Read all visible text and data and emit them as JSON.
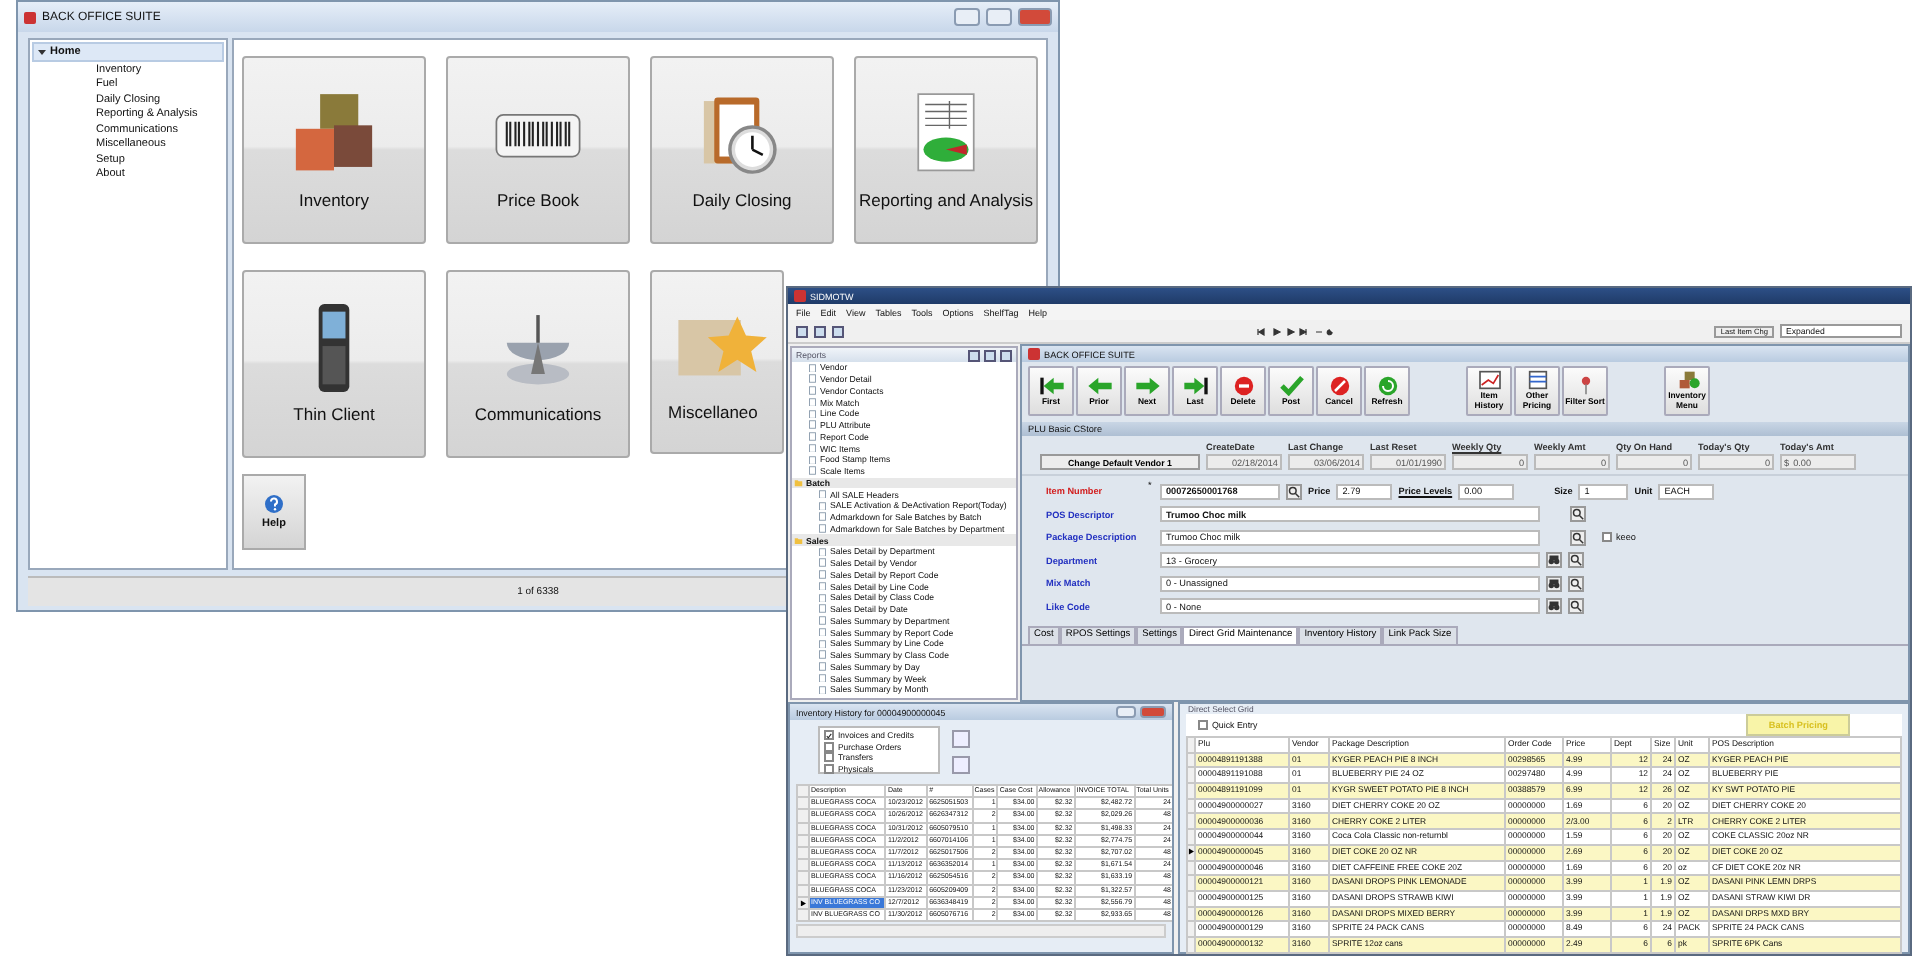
{
  "home_window": {
    "title": "BACK OFFICE SUITE",
    "sidebar": {
      "items": [
        {
          "label": "Home",
          "selected": true,
          "expanded": true,
          "children": [
            {
              "label": "Inventory",
              "selected": false
            },
            {
              "label": "Fuel",
              "selected": false
            },
            {
              "label": "Daily Closing",
              "selected": false
            },
            {
              "label": "Reporting & Analysis",
              "selected": false
            },
            {
              "label": "Communications",
              "selected": false
            },
            {
              "label": "Miscellaneous",
              "selected": false
            },
            {
              "label": "Setup",
              "selected": false
            },
            {
              "label": "About",
              "selected": false
            }
          ]
        }
      ]
    },
    "tiles": [
      {
        "label": "Inventory"
      },
      {
        "label": "Price Book"
      },
      {
        "label": "Daily Closing"
      },
      {
        "label": "Reporting and Analysis"
      },
      {
        "label": "Thin Client"
      },
      {
        "label": "Communications"
      },
      {
        "label": "Miscellaneo"
      }
    ],
    "help": {
      "label": "Help"
    },
    "status_bar": "1 of 6338"
  },
  "main_window": {
    "title": "SIDMOTW",
    "menu": [
      "File",
      "Edit",
      "View",
      "Tables",
      "Tools",
      "Options",
      "ShelfTag",
      "Help"
    ],
    "toolbar": {
      "last_item_button": "Last Item Chg",
      "view_select": "Expanded"
    },
    "reports": {
      "title": "Reports",
      "items": [
        {
          "kind": "leaf",
          "label": "Vendor"
        },
        {
          "kind": "leaf",
          "label": "Vendor Detail"
        },
        {
          "kind": "leaf",
          "label": "Vendor Contacts"
        },
        {
          "kind": "leaf",
          "label": "Mix Match"
        },
        {
          "kind": "leaf",
          "label": "Line Code"
        },
        {
          "kind": "leaf",
          "label": "PLU Attribute"
        },
        {
          "kind": "leaf",
          "label": "Report Code"
        },
        {
          "kind": "leaf",
          "label": "WIC Items"
        },
        {
          "kind": "leaf",
          "label": "Food Stamp Items"
        },
        {
          "kind": "leaf",
          "label": "Scale Items"
        },
        {
          "kind": "folder",
          "label": "Batch",
          "children": [
            {
              "kind": "leaf",
              "label": "All SALE Headers"
            },
            {
              "kind": "leaf",
              "label": "SALE Activation & DeActivation  Report(Today)"
            },
            {
              "kind": "leaf",
              "label": "Admarkdown for Sale Batches by Batch"
            },
            {
              "kind": "leaf",
              "label": "Admarkdown for Sale Batches by Department"
            }
          ]
        },
        {
          "kind": "folder",
          "label": "Sales",
          "children": [
            {
              "kind": "leaf",
              "label": "Sales Detail by Department"
            },
            {
              "kind": "leaf",
              "label": "Sales Detail by Vendor"
            },
            {
              "kind": "leaf",
              "label": "Sales Detail by Report Code"
            },
            {
              "kind": "leaf",
              "label": "Sales Detail by Line Code"
            },
            {
              "kind": "leaf",
              "label": "Sales Detail by Class Code"
            },
            {
              "kind": "leaf",
              "label": "Sales Detail by Date"
            },
            {
              "kind": "leaf",
              "label": "Sales Summary by Department"
            },
            {
              "kind": "leaf",
              "label": "Sales Summary by Report Code"
            },
            {
              "kind": "leaf",
              "label": "Sales Summary by Line Code"
            },
            {
              "kind": "leaf",
              "label": "Sales Summary by Class Code"
            },
            {
              "kind": "leaf",
              "label": "Sales Summary by Day"
            },
            {
              "kind": "leaf",
              "label": "Sales Summary by Week"
            },
            {
              "kind": "leaf",
              "label": "Sales Summary by Month"
            }
          ]
        }
      ]
    },
    "plu_window": {
      "title": "BACK OFFICE SUITE",
      "buttons": [
        {
          "label": "First"
        },
        {
          "label": "Prior"
        },
        {
          "label": "Next"
        },
        {
          "label": "Last"
        },
        {
          "label": "Delete"
        },
        {
          "label": "Post"
        },
        {
          "label": "Cancel"
        },
        {
          "label": "Refresh"
        },
        {
          "label": "Item History"
        },
        {
          "label": "Other Pricing"
        },
        {
          "label": "Filter Sort"
        },
        {
          "label": "Inventory Menu"
        }
      ],
      "section_title": "PLU Basic CStore",
      "vendor_button": "Change Default Vendor 1",
      "header_fields": [
        {
          "label": "CreateDate",
          "value": "02/18/2014",
          "underlined": false
        },
        {
          "label": "Last Change",
          "value": "03/06/2014",
          "underlined": false
        },
        {
          "label": "Last Reset",
          "value": "01/01/1990",
          "underlined": false
        },
        {
          "label": "Weekly Qty",
          "value": "0",
          "underlined": true
        },
        {
          "label": "Weekly Amt",
          "value": "0",
          "underlined": false
        },
        {
          "label": "Qty On Hand",
          "value": "0",
          "underlined": false
        },
        {
          "label": "Today's Qty",
          "value": "0",
          "underlined": false
        },
        {
          "label": "Today's Amt",
          "prefix": "$",
          "value": "0.00",
          "underlined": false
        }
      ],
      "item_number": {
        "label": "Item Number",
        "mark": "*",
        "value": "00072650001768"
      },
      "price": {
        "label": "Price",
        "value": "2.79"
      },
      "price_levels": {
        "label": "Price Levels",
        "value": "0.00"
      },
      "size": {
        "label": "Size",
        "value": "1"
      },
      "unit": {
        "label": "Unit",
        "value": "EACH"
      },
      "descriptor_fields": [
        {
          "label": "POS Descriptor",
          "value": "Trumoo Choc milk",
          "bold": true
        },
        {
          "label": "Package Description",
          "value": "Trumoo Choc milk",
          "bold": false
        }
      ],
      "keeo": {
        "label": "keeo",
        "checked": false
      },
      "lookup_fields": [
        {
          "label": "Department",
          "value": "13 - Grocery"
        },
        {
          "label": "Mix Match",
          "value": "0 - Unassigned"
        },
        {
          "label": "Like Code",
          "value": "0 - None"
        }
      ],
      "tabs": [
        {
          "label": "Cost",
          "selected": false
        },
        {
          "label": "RPOS Settings",
          "selected": false
        },
        {
          "label": "Settings",
          "selected": false
        },
        {
          "label": "Direct Grid Maintenance",
          "selected": true
        },
        {
          "label": "Inventory History",
          "selected": false
        },
        {
          "label": "Link Pack Size",
          "selected": false
        }
      ]
    }
  },
  "inventory_history": {
    "title": "Inventory History for 00004900000045",
    "filters": [
      {
        "label": "Invoices and Credits",
        "checked": true
      },
      {
        "label": "Purchase Orders",
        "checked": false
      },
      {
        "label": "Transfers",
        "checked": false
      },
      {
        "label": "Physicals",
        "checked": false
      }
    ],
    "columns": [
      "Description",
      "Date",
      "#",
      "Cases",
      "Case Cost",
      "Allowance",
      "INVOICE TOTAL",
      "Total Units"
    ],
    "rows": [
      {
        "selected": false,
        "cells": [
          "BLUEGRASS COCA",
          "10/23/2012",
          "6625051503",
          "1",
          "$34.00",
          "$2.32",
          "$2,482.72",
          "24"
        ]
      },
      {
        "selected": false,
        "cells": [
          "BLUEGRASS COCA",
          "10/26/2012",
          "6626347312",
          "2",
          "$34.00",
          "$2.32",
          "$2,029.26",
          "48"
        ]
      },
      {
        "selected": false,
        "cells": [
          "BLUEGRASS COCA",
          "10/31/2012",
          "6605079510",
          "1",
          "$34.00",
          "$2.32",
          "$1,498.33",
          "24"
        ]
      },
      {
        "selected": false,
        "cells": [
          "BLUEGRASS COCA",
          "11/2/2012",
          "6607014106",
          "1",
          "$34.00",
          "$2.32",
          "$2,774.75",
          "24"
        ]
      },
      {
        "selected": false,
        "cells": [
          "BLUEGRASS COCA",
          "11/7/2012",
          "6625017506",
          "2",
          "$34.00",
          "$2.32",
          "$2,707.02",
          "48"
        ]
      },
      {
        "selected": false,
        "cells": [
          "BLUEGRASS COCA",
          "11/13/2012",
          "6636352014",
          "1",
          "$34.00",
          "$2.32",
          "$1,671.54",
          "24"
        ]
      },
      {
        "selected": false,
        "cells": [
          "BLUEGRASS COCA",
          "11/16/2012",
          "6625054516",
          "2",
          "$34.00",
          "$2.32",
          "$1,633.19",
          "48"
        ]
      },
      {
        "selected": false,
        "cells": [
          "BLUEGRASS COCA",
          "11/23/2012",
          "6605209409",
          "2",
          "$34.00",
          "$2.32",
          "$1,322.57",
          "48"
        ]
      },
      {
        "selected": true,
        "cells": [
          "INV BLUEGRASS CO",
          "12/7/2012",
          "6636348419",
          "2",
          "$34.00",
          "$2.32",
          "$2,556.79",
          "48"
        ]
      },
      {
        "selected": false,
        "cells": [
          "INV BLUEGRASS CO",
          "11/30/2012",
          "6605076716",
          "2",
          "$34.00",
          "$2.32",
          "$2,933.65",
          "48"
        ]
      }
    ]
  },
  "direct_grid": {
    "title": "Direct Select Grid",
    "quick_entry": {
      "label": "Quick Entry",
      "checked": false
    },
    "batch_button": "Batch Pricing",
    "columns": [
      "Plu",
      "Vendor",
      "Package Description",
      "Order Code",
      "Price",
      "Dept",
      "Size",
      "Unit",
      "POS Description"
    ],
    "rows": [
      {
        "selected": false,
        "cells": [
          "00004891191388",
          "01",
          "KYGER PEACH PIE 8 INCH",
          "00298565",
          "4.99",
          "12",
          "24",
          "OZ",
          "KYGER PEACH PIE"
        ]
      },
      {
        "selected": false,
        "cells": [
          "00004891191088",
          "01",
          "BLUEBERRY PIE 24 OZ",
          "00297480",
          "4.99",
          "12",
          "24",
          "OZ",
          "BLUEBERRY PIE"
        ]
      },
      {
        "selected": false,
        "cells": [
          "00004891191099",
          "01",
          "KYGR SWEET POTATO PIE 8 INCH",
          "00388579",
          "6.99",
          "12",
          "26",
          "OZ",
          "KY SWT POTATO PIE"
        ]
      },
      {
        "selected": false,
        "cells": [
          "00004900000027",
          "3160",
          "DIET CHERRY COKE 20 OZ",
          "00000000",
          "1.69",
          "6",
          "20",
          "OZ",
          "DIET CHERRY COKE 20"
        ]
      },
      {
        "selected": false,
        "cells": [
          "00004900000036",
          "3160",
          "CHERRY COKE 2 LITER",
          "00000000",
          "2/3.00",
          "6",
          "2",
          "LTR",
          "CHERRY COKE 2 LITER"
        ]
      },
      {
        "selected": false,
        "cells": [
          "00004900000044",
          "3160",
          "Coca Cola Classic non-returnbl",
          "00000000",
          "1.59",
          "6",
          "20",
          "OZ",
          "COKE CLASSIC 20oz NR"
        ]
      },
      {
        "selected": true,
        "cells": [
          "00004900000045",
          "3160",
          "DIET COKE 20 OZ NR",
          "00000000",
          "2.69",
          "6",
          "20",
          "OZ",
          "DIET COKE 20 OZ"
        ]
      },
      {
        "selected": false,
        "cells": [
          "00004900000046",
          "3160",
          "DIET CAFFEINE FREE COKE 20Z",
          "00000000",
          "1.69",
          "6",
          "20",
          "oz",
          "CF DIET COKE 20z NR"
        ]
      },
      {
        "selected": false,
        "cells": [
          "00004900000121",
          "3160",
          "DASANI DROPS PINK LEMONADE",
          "00000000",
          "3.99",
          "1",
          "1.9",
          "OZ",
          "DASANI PINK LEMN DRPS"
        ]
      },
      {
        "selected": false,
        "cells": [
          "00004900000125",
          "3160",
          "DASANI DROPS STRAWB KIWI",
          "00000000",
          "3.99",
          "1",
          "1.9",
          "OZ",
          "DASANI STRAW KIWI DR"
        ]
      },
      {
        "selected": false,
        "cells": [
          "00004900000126",
          "3160",
          "DASANI DROPS MIXED BERRY",
          "00000000",
          "3.99",
          "1",
          "1.9",
          "OZ",
          "DASANI DRPS MXD BRY"
        ]
      },
      {
        "selected": false,
        "cells": [
          "00004900000129",
          "3160",
          "SPRITE 24 PACK CANS",
          "00000000",
          "8.49",
          "6",
          "24",
          "PACK",
          "SPRITE 24 PACK CANS"
        ]
      },
      {
        "selected": false,
        "cells": [
          "00004900000132",
          "3160",
          "SPRITE 12oz cans",
          "00000000",
          "2.49",
          "6",
          "6",
          "pk",
          "SPRITE 6PK Cans"
        ]
      }
    ]
  }
}
